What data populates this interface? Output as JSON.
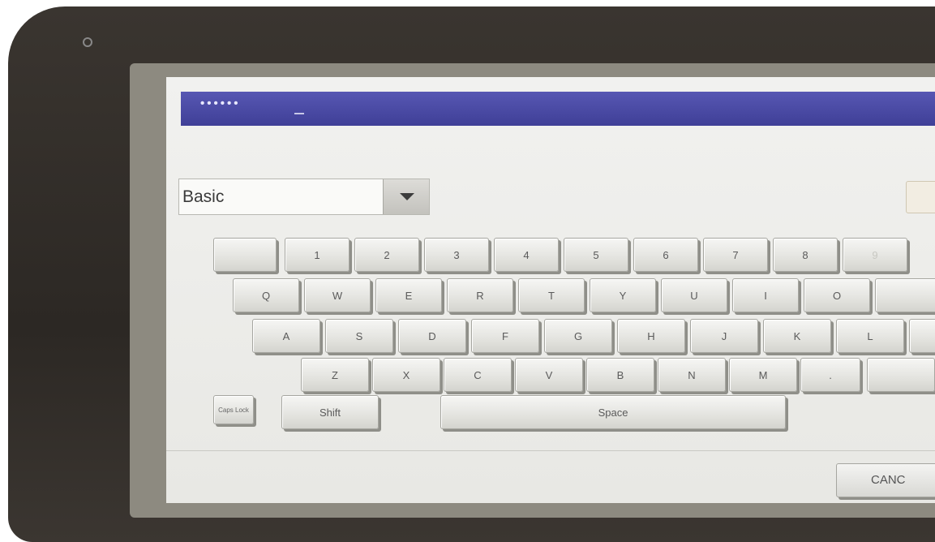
{
  "entry": {
    "masked_value": "••••••"
  },
  "mode_select": {
    "label": "Basic"
  },
  "keys": {
    "row1": [
      "",
      "1",
      "2",
      "3",
      "4",
      "5",
      "6",
      "7",
      "8",
      "9"
    ],
    "row2": [
      "Q",
      "W",
      "E",
      "R",
      "T",
      "Y",
      "U",
      "I",
      "O",
      ""
    ],
    "row3": [
      "A",
      "S",
      "D",
      "F",
      "G",
      "H",
      "J",
      "K",
      "L",
      ""
    ],
    "row4": [
      "Z",
      "X",
      "C",
      "V",
      "B",
      "N",
      "M",
      ".",
      ""
    ],
    "caps_lock": "Caps Lock",
    "shift": "Shift",
    "space": "Space"
  },
  "actions": {
    "cancel_label": "CANC"
  }
}
